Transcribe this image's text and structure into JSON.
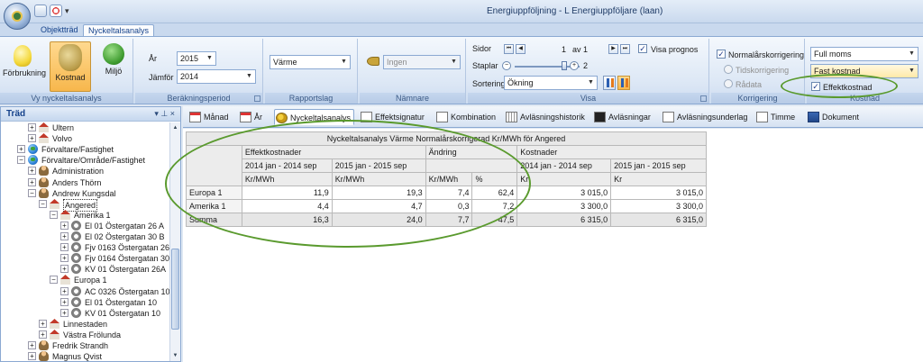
{
  "window": {
    "title": "Energiuppföljning - L Energiuppföljare (laan)"
  },
  "ribbon_tabs": [
    "Objektträd",
    "Nyckeltalsanalys"
  ],
  "ribbon": {
    "vy": {
      "label": "Vy nyckeltalsanalys",
      "buttons": [
        "Förbrukning",
        "Kostnad",
        "Miljö"
      ]
    },
    "period": {
      "label": "Beräkningsperiod",
      "year_label": "År",
      "year_value": "2015",
      "compare_label": "Jämför",
      "compare_value": "2014"
    },
    "rapportslag": {
      "label": "Rapportslag",
      "value": "Värme"
    },
    "namnare": {
      "label": "Nämnare",
      "value": "Ingen"
    },
    "visa": {
      "label": "Visa",
      "sidor_label": "Sidor",
      "page_current": "1",
      "page_of": "av 1",
      "visa_prognos": "Visa prognos",
      "staplar_label": "Staplar",
      "staplar_value": "2",
      "sortering_label": "Sortering",
      "sortering_value": "Ökning"
    },
    "korrigering": {
      "label": "Korrigering",
      "normal": "Normalårskorrigering",
      "tid": "Tidskorrigering",
      "radata": "Rådata"
    },
    "kostnad": {
      "label": "Kostnad",
      "moms_value": "Full moms",
      "fast_value": "Fast kostnad",
      "effekt": "Effektkostnad"
    }
  },
  "tree": {
    "title": "Träd",
    "nodes": [
      {
        "label": "Ultern",
        "expander": "+",
        "icon": "house"
      },
      {
        "label": "Volvo",
        "expander": "+",
        "icon": "house"
      },
      {
        "label": "Förvaltare/Fastighet",
        "expander": "+",
        "icon": "globe"
      },
      {
        "label": "Förvaltare/Område/Fastighet",
        "expander": "−",
        "icon": "globe"
      },
      {
        "label": "Administration",
        "expander": "+",
        "icon": "person"
      },
      {
        "label": "Anders Thörn",
        "expander": "+",
        "icon": "person"
      },
      {
        "label": "Andrew Kungsdal",
        "expander": "−",
        "icon": "person"
      },
      {
        "label": "Angered",
        "expander": "−",
        "icon": "house"
      },
      {
        "label": "Amerika 1",
        "expander": "−",
        "icon": "house"
      },
      {
        "label": "El 01 Östergatan 26 A",
        "expander": "+",
        "icon": "meter"
      },
      {
        "label": "El 02 Östergatan 30 B",
        "expander": "+",
        "icon": "meter"
      },
      {
        "label": "Fjv 0163 Östergatan 26A",
        "expander": "+",
        "icon": "meter"
      },
      {
        "label": "Fjv 0164 Östergatan 30A",
        "expander": "+",
        "icon": "meter"
      },
      {
        "label": "KV 01 Östergatan 26A",
        "expander": "+",
        "icon": "meter"
      },
      {
        "label": "Europa 1",
        "expander": "−",
        "icon": "house"
      },
      {
        "label": "AC 0326 Östergatan 10",
        "expander": "+",
        "icon": "meter"
      },
      {
        "label": "El 01 Östergatan 10",
        "expander": "+",
        "icon": "meter"
      },
      {
        "label": "KV 01 Östergatan 10",
        "expander": "+",
        "icon": "meter"
      },
      {
        "label": "Linnestaden",
        "expander": "+",
        "icon": "house"
      },
      {
        "label": "Västra Frölunda",
        "expander": "+",
        "icon": "house"
      },
      {
        "label": "Fredrik Strandh",
        "expander": "+",
        "icon": "person"
      },
      {
        "label": "Magnus Qvist",
        "expander": "+",
        "icon": "person"
      }
    ]
  },
  "view_tabs": [
    "Månad",
    "År",
    "Nyckeltalsanalys",
    "Effektsignatur",
    "Kombination",
    "Avläsningshistorik",
    "Avläsningar",
    "Avläsningsunderlag",
    "Timme",
    "Dokument"
  ],
  "table": {
    "caption": "Nyckeltalsanalys Värme Normalårskorrigerad Kr/MWh för Angered",
    "groups": [
      "Effektkostnader",
      "Ändring",
      "Kostnader"
    ],
    "periods": [
      "2014 jan - 2014 sep",
      "2015 jan - 2015 sep",
      "2014 jan - 2014 sep",
      "2015 jan - 2015 sep"
    ],
    "units": [
      "Kr/MWh",
      "Kr/MWh",
      "Kr/MWh",
      "%",
      "Kr",
      "Kr"
    ],
    "rows": [
      {
        "name": "Europa 1",
        "values": [
          "11,9",
          "19,3",
          "7,4",
          "62,4",
          "3 015,0",
          "3 015,0"
        ]
      },
      {
        "name": "Amerika 1",
        "values": [
          "4,4",
          "4,7",
          "0,3",
          "7,2",
          "3 300,0",
          "3 300,0"
        ]
      },
      {
        "name": "Summa",
        "values": [
          "16,3",
          "24,0",
          "7,7",
          "47,5",
          "6 315,0",
          "6 315,0"
        ]
      }
    ]
  },
  "colors": {
    "annotation": "#5a9a2e",
    "ribbon_selected": "#f7b74c"
  }
}
